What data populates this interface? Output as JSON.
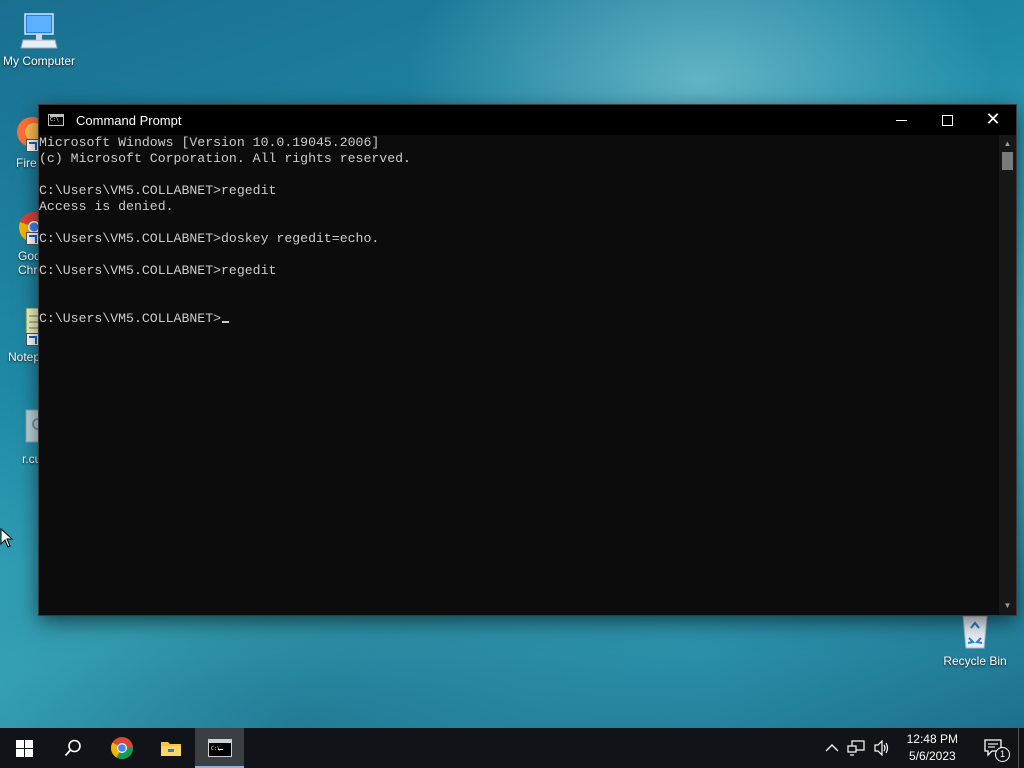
{
  "desktop": {
    "icons": [
      {
        "label": "My Computer"
      },
      {
        "label": "Fire"
      },
      {
        "label": "Goo\nChro"
      },
      {
        "label": "Notep"
      },
      {
        "label": "r.cu"
      },
      {
        "label": "Recycle Bin"
      }
    ]
  },
  "window": {
    "title": "Command Prompt",
    "console_lines": [
      "Microsoft Windows [Version 10.0.19045.2006]",
      "(c) Microsoft Corporation. All rights reserved.",
      "",
      "C:\\Users\\VM5.COLLABNET>regedit",
      "Access is denied.",
      "",
      "C:\\Users\\VM5.COLLABNET>doskey regedit=echo.",
      "",
      "C:\\Users\\VM5.COLLABNET>regedit",
      "",
      "",
      "C:\\Users\\VM5.COLLABNET>"
    ]
  },
  "taskbar": {
    "clock_time": "12:48 PM",
    "clock_date": "5/6/2023",
    "notification_count": "1"
  },
  "colors": {
    "console_bg": "#0c0c0c",
    "console_text": "#cccccc",
    "taskbar_bg": "#101418"
  }
}
